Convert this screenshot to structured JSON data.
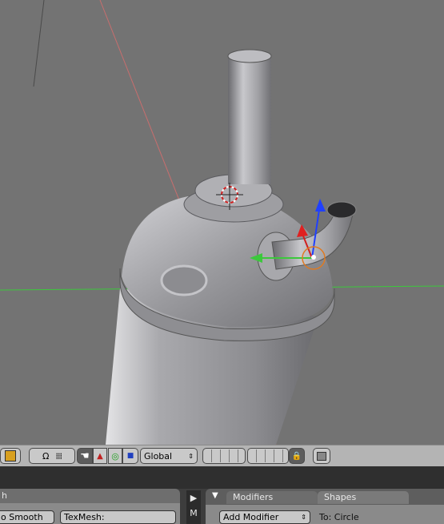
{
  "header": {
    "orientation": "Global"
  },
  "panel_left": {
    "title": "h",
    "smooth_label": "o Smooth",
    "texmesh_label": "TexMesh:"
  },
  "side_tabs": {
    "play": "▶",
    "m": "M"
  },
  "panel_right": {
    "tabs": [
      "Modifiers",
      "Shapes"
    ],
    "add_modifier": "Add Modifier",
    "to_label": "To: Circle"
  },
  "colors": {
    "viewport_bg": "#737373",
    "x_axis": "#3cc83c",
    "y_axis": "#c85050",
    "z_axis": "#2040ff"
  }
}
